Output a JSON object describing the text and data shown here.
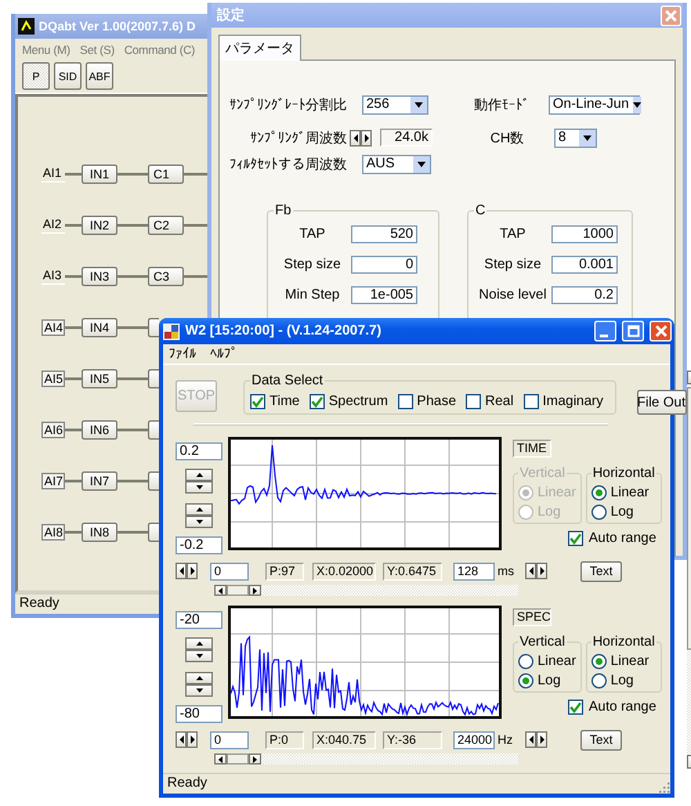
{
  "main_window": {
    "title": "DQabt Ver 1.00(2007.7.6) D",
    "menu": [
      "Menu (M)",
      "Set (S)",
      "Command (C)"
    ],
    "toolbar": [
      {
        "label": "P",
        "selected": true
      },
      {
        "label": "SID",
        "selected": false
      },
      {
        "label": "ABF",
        "selected": false
      }
    ],
    "channels": [
      {
        "input": "AI1",
        "filter": "IN1",
        "output": "C1",
        "highlighted": false
      },
      {
        "input": "AI2",
        "filter": "IN2",
        "output": "C2",
        "highlighted": false
      },
      {
        "input": "AI3",
        "filter": "IN3",
        "output": "C3",
        "highlighted": false
      },
      {
        "input": "AI4",
        "filter": "IN4",
        "highlighted": true
      },
      {
        "input": "AI5",
        "filter": "IN5",
        "highlighted": true
      },
      {
        "input": "AI6",
        "filter": "IN6",
        "highlighted": true
      },
      {
        "input": "AI7",
        "filter": "IN7",
        "highlighted": true
      },
      {
        "input": "AI8",
        "filter": "IN8",
        "highlighted": true
      }
    ],
    "status": "Ready"
  },
  "settings_dialog": {
    "title": "設定",
    "tabs": [
      {
        "label": "パラメータ",
        "selected": true
      }
    ],
    "left_fields": [
      {
        "label": "ｻﾝﾌﾟﾘﾝｸﾞﾚｰﾄ分割比",
        "kind": "combo",
        "value": "256"
      },
      {
        "label": "ｻﾝﾌﾟﾘﾝｸﾞ周波数",
        "kind": "spin",
        "value": "24.0k"
      },
      {
        "label": "ﾌｨﾙﾀｾｯﾄする周波数",
        "kind": "combo",
        "value": "AUS"
      }
    ],
    "right_fields": [
      {
        "label": "動作ﾓｰﾄﾞ",
        "kind": "combo",
        "value": "On-Line-Jun"
      },
      {
        "label": "CH数",
        "kind": "combo",
        "value": "8"
      }
    ],
    "groups": [
      {
        "label": "Fb",
        "fields": [
          {
            "label": "TAP",
            "value": "520"
          },
          {
            "label": "Step size",
            "value": "0"
          },
          {
            "label": "Min Step",
            "value": "1e-005"
          }
        ]
      },
      {
        "label": "C",
        "fields": [
          {
            "label": "TAP",
            "value": "1000"
          },
          {
            "label": "Step size",
            "value": "0.001"
          },
          {
            "label": "Noise level",
            "value": "0.2"
          }
        ]
      }
    ]
  },
  "scope_window": {
    "title": "W2 [15:20:00] - (V.1.24-2007.7)",
    "menu": [
      "ﾌｧｲﾙ",
      "ﾍﾙﾌﾟ"
    ],
    "stop_button": {
      "label": "STOP",
      "disabled": true
    },
    "data_select": {
      "label": "Data Select",
      "options": [
        {
          "label": "Time",
          "checked": true
        },
        {
          "label": "Spectrum",
          "checked": true
        },
        {
          "label": "Phase",
          "checked": false
        },
        {
          "label": "Real",
          "checked": false
        },
        {
          "label": "Imaginary",
          "checked": false
        }
      ]
    },
    "file_out_button": "File Out",
    "panels": [
      {
        "kind": "time",
        "max": "0.2",
        "min": "-0.2",
        "name": "TIME",
        "vertical": {
          "label": "Vertical",
          "disabled": true,
          "options": [
            {
              "label": "Linear",
              "selected": true
            },
            {
              "label": "Log",
              "selected": false
            }
          ]
        },
        "horizontal": {
          "label": "Horizontal",
          "disabled": false,
          "options": [
            {
              "label": "Linear",
              "selected": true
            },
            {
              "label": "Log",
              "selected": false
            }
          ]
        },
        "auto_range": {
          "label": "Auto range",
          "checked": true
        },
        "start": "0",
        "point": "P:97",
        "x_reading": "X:0.02000",
        "y_reading": "Y:0.6475",
        "span": "128",
        "unit": "ms",
        "text_button": "Text"
      },
      {
        "kind": "spectrum",
        "max": "-20",
        "min": "-80",
        "name": "SPEC",
        "vertical": {
          "label": "Vertical",
          "disabled": false,
          "options": [
            {
              "label": "Linear",
              "selected": false
            },
            {
              "label": "Log",
              "selected": true
            }
          ]
        },
        "horizontal": {
          "label": "Horizontal",
          "disabled": false,
          "options": [
            {
              "label": "Linear",
              "selected": true
            },
            {
              "label": "Log",
              "selected": false
            }
          ]
        },
        "auto_range": {
          "label": "Auto range",
          "checked": true
        },
        "start": "0",
        "point": "P:0",
        "x_reading": "X:040.75",
        "y_reading": "Y:-36",
        "span": "24000",
        "unit": "Hz",
        "text_button": "Text"
      }
    ],
    "status": "Ready"
  }
}
